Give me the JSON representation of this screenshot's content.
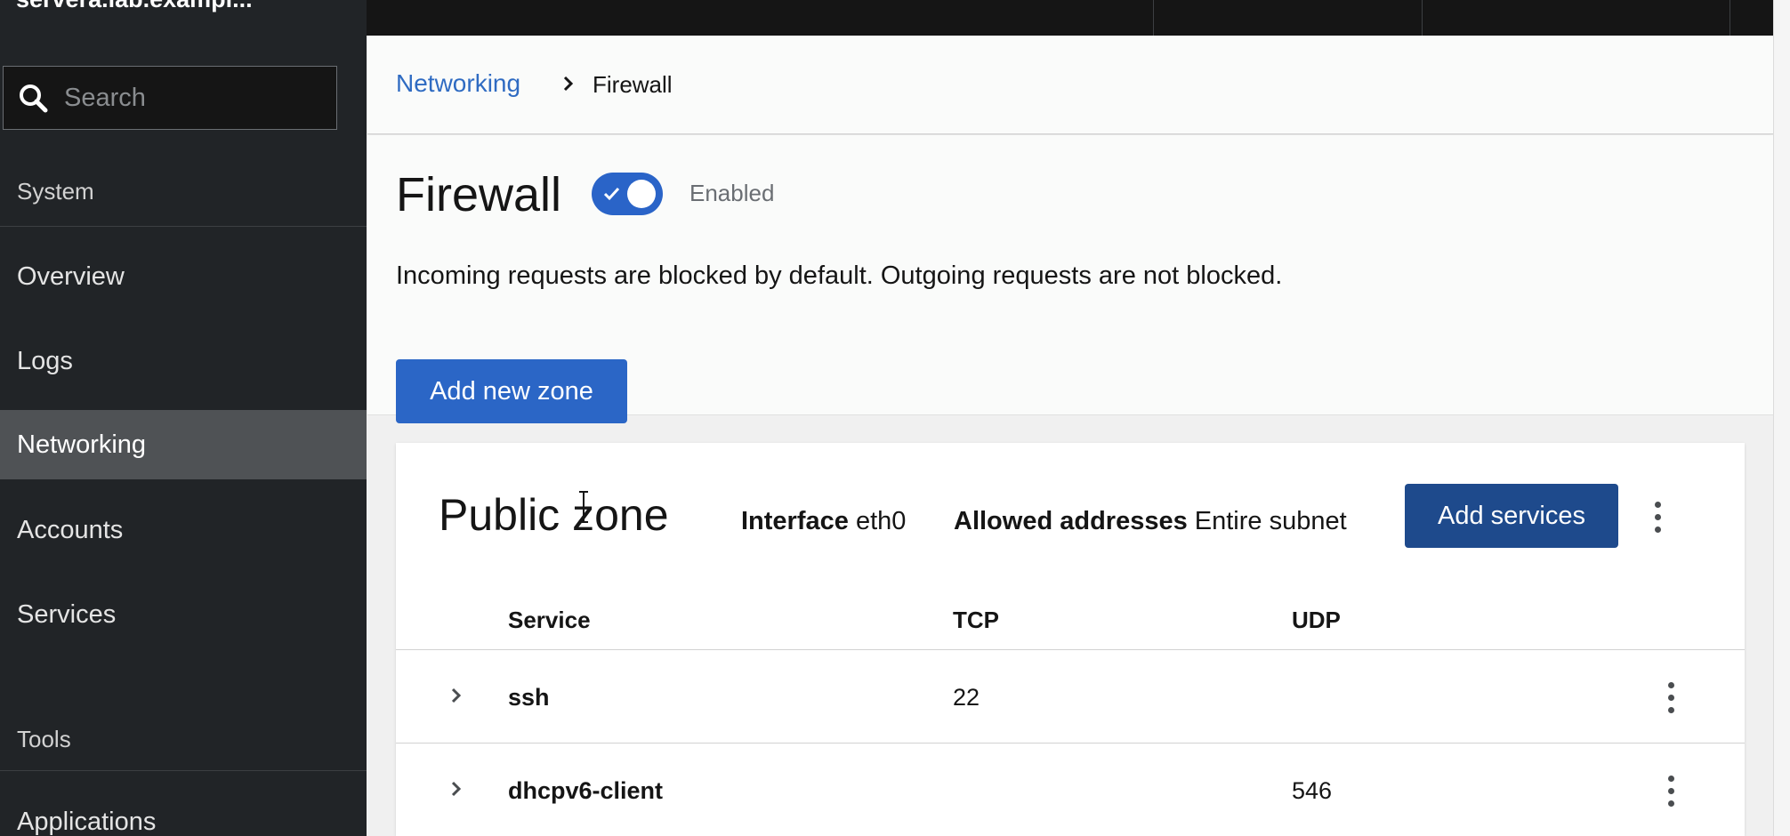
{
  "sidebar": {
    "host_title": "servera.lab.exampl...",
    "search_placeholder": "Search",
    "heading_system": "System",
    "items": [
      {
        "label": "Overview"
      },
      {
        "label": "Logs"
      },
      {
        "label": "Networking"
      },
      {
        "label": "Accounts"
      },
      {
        "label": "Services"
      }
    ],
    "heading_tools": "Tools",
    "tools_items": [
      {
        "label": "Applications"
      }
    ]
  },
  "breadcrumb": {
    "parent": "Networking",
    "current": "Firewall"
  },
  "header": {
    "title": "Firewall",
    "toggle_label": "Enabled",
    "toggle_on": true,
    "description": "Incoming requests are blocked by default. Outgoing requests are not blocked.",
    "add_zone_label": "Add new zone"
  },
  "zone": {
    "title": "Public zone",
    "interface_label": "Interface",
    "interface_value": "eth0",
    "addresses_label": "Allowed addresses",
    "addresses_value": "Entire subnet",
    "add_services_label": "Add services",
    "columns": [
      "Service",
      "TCP",
      "UDP"
    ],
    "rows": [
      {
        "service": "ssh",
        "tcp": "22",
        "udp": ""
      },
      {
        "service": "dhcpv6-client",
        "tcp": "",
        "udp": "546"
      }
    ]
  },
  "colors": {
    "accent": "#2b66c6",
    "sidebar_bg": "#212427",
    "link": "#2f6bc2"
  }
}
